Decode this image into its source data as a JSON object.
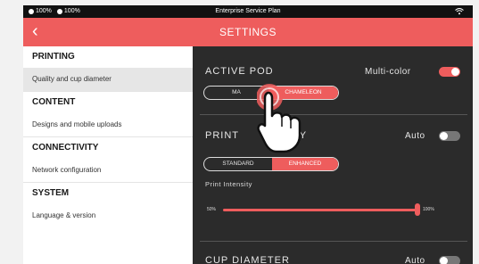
{
  "statusbar": {
    "battery_1": "100%",
    "battery_2": "100%",
    "title": "Enterprise Service Plan",
    "wifi_icon": "wifi-icon"
  },
  "appbar": {
    "back_icon": "chevron-left-icon",
    "back_glyph": "‹",
    "title": "SETTINGS"
  },
  "sidebar": {
    "sections": [
      {
        "heading": "PRINTING",
        "item": "Quality and cup diameter"
      },
      {
        "heading": "CONTENT",
        "item": "Designs and mobile uploads"
      },
      {
        "heading": "CONNECTIVITY",
        "item": "Network configuration"
      },
      {
        "heading": "SYSTEM",
        "item": "Language & version"
      }
    ]
  },
  "panel": {
    "active_pod": {
      "title": "ACTIVE POD",
      "toggle_label": "Multi-color",
      "toggle_on": true,
      "options": [
        "MA",
        "CHAMELEON"
      ]
    },
    "print_quality": {
      "title_left": "PRINT",
      "title_right": "TY",
      "toggle_label": "Auto",
      "toggle_on": false,
      "options": [
        "STANDARD",
        "ENHANCED"
      ],
      "intensity_label": "Print Intensity",
      "min_label": "50%",
      "max_label": "100%",
      "value_pct": 100
    },
    "cup_diameter": {
      "title": "CUP DIAMETER",
      "toggle_label": "Auto",
      "toggle_on": false
    }
  },
  "colors": {
    "accent": "#ee5d5d",
    "panel_bg": "#2b2b2b",
    "statusbar_bg": "#111111"
  },
  "overlay": {
    "icon": "hand-pointer-icon"
  }
}
